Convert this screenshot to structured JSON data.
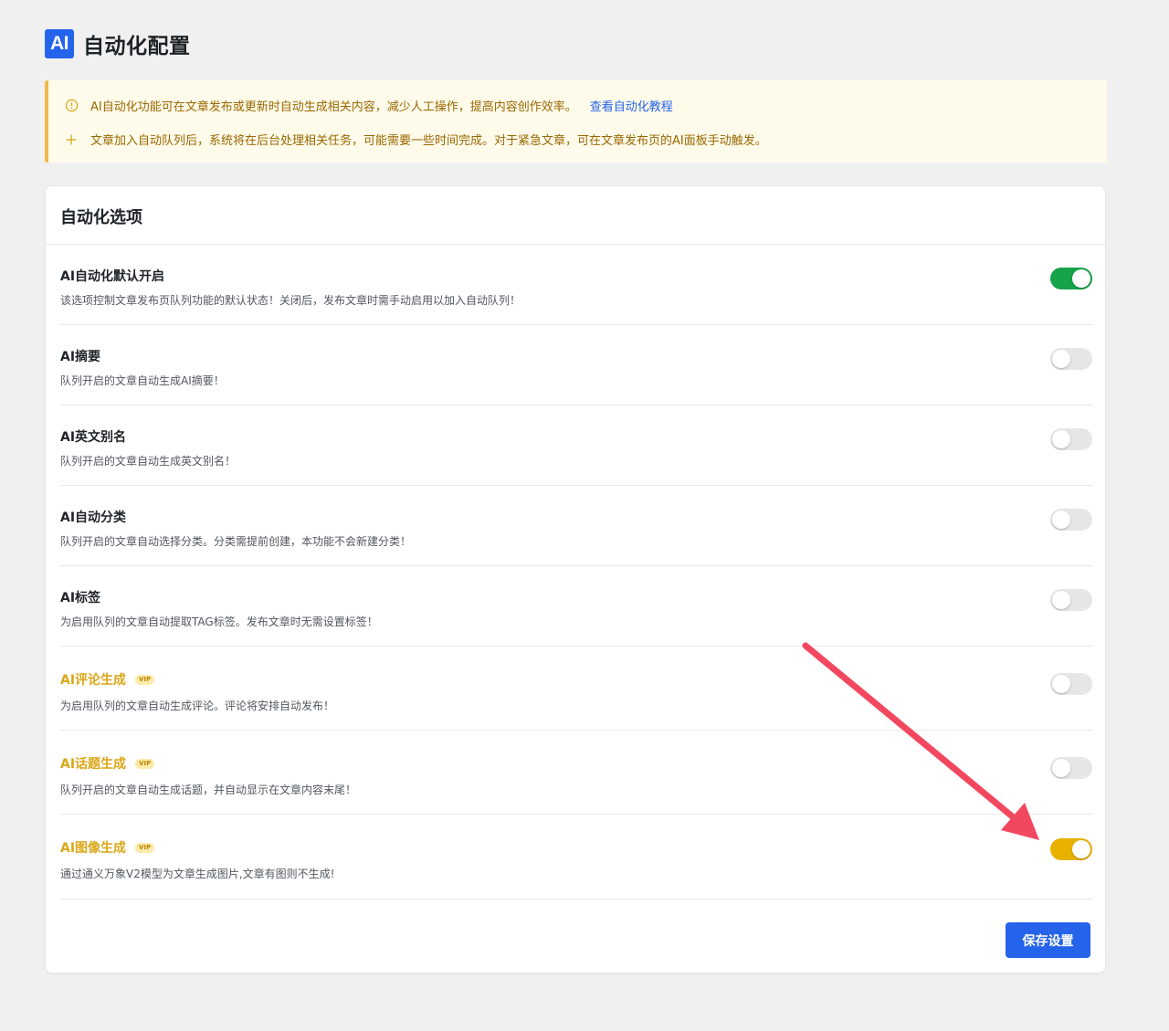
{
  "header": {
    "logo_text": "AI",
    "title": "自动化配置"
  },
  "notice": {
    "line1": "AI自动化功能可在文章发布或更新时自动生成相关内容，减少人工操作，提高内容创作效率。",
    "link": "查看自动化教程",
    "line2": "文章加入自动队列后，系统将在后台处理相关任务，可能需要一些时间完成。对于紧急文章，可在文章发布页的AI面板手动触发。",
    "icons": [
      "info-circle-icon",
      "plus-icon"
    ]
  },
  "card": {
    "title": "自动化选项",
    "options": [
      {
        "title": "AI自动化默认开启",
        "desc": "该选项控制文章发布页队列功能的默认状态！关闭后，发布文章时需手动启用以加入自动队列！",
        "vip": false,
        "enabled": true
      },
      {
        "title": "AI摘要",
        "desc": "队列开启的文章自动生成AI摘要！",
        "vip": false,
        "enabled": false
      },
      {
        "title": "AI英文别名",
        "desc": "队列开启的文章自动生成英文别名！",
        "vip": false,
        "enabled": false
      },
      {
        "title": "AI自动分类",
        "desc": "队列开启的文章自动选择分类。分类需提前创建，本功能不会新建分类！",
        "vip": false,
        "enabled": false
      },
      {
        "title": "AI标签",
        "desc": "为启用队列的文章自动提取TAG标签。发布文章时无需设置标签！",
        "vip": false,
        "enabled": false
      },
      {
        "title": "AI评论生成",
        "desc": "为启用队列的文章自动生成评论。评论将安排自动发布！",
        "vip": true,
        "enabled": false
      },
      {
        "title": "AI话题生成",
        "desc": "队列开启的文章自动生成话题，并自动显示在文章内容末尾！",
        "vip": true,
        "enabled": false
      },
      {
        "title": "AI图像生成",
        "desc": "通过通义万象V2模型为文章生成图片,文章有图则不生成!",
        "vip": true,
        "enabled": true
      }
    ],
    "vip_label": "VIP",
    "save_label": "保存设置"
  },
  "colors": {
    "accent": "#2563eb",
    "toggle_on": "#16a34a",
    "vip_toggle_on": "#e8b100",
    "vip_text": "#dba617",
    "notice_bg": "#fefbea",
    "notice_border": "#f0b849",
    "arrow": "#f2485f"
  }
}
